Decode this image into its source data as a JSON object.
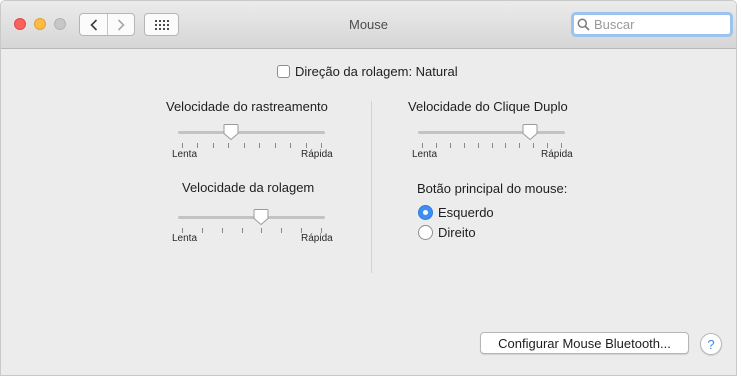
{
  "window": {
    "title": "Mouse",
    "search_placeholder": "Buscar"
  },
  "scroll_direction": {
    "label": "Direção da rolagem: Natural",
    "checked": false
  },
  "tracking_speed": {
    "label": "Velocidade do rastreamento",
    "min_label": "Lenta",
    "max_label": "Rápida",
    "value": 0.35
  },
  "scroll_speed": {
    "label": "Velocidade da rolagem",
    "min_label": "Lenta",
    "max_label": "Rápida",
    "value": 0.57
  },
  "double_click_speed": {
    "label": "Velocidade do Clique Duplo",
    "min_label": "Lenta",
    "max_label": "Rápida",
    "value": 0.78
  },
  "primary_button": {
    "label": "Botão principal do mouse:",
    "options": [
      "Esquerdo",
      "Direito"
    ],
    "selected": "Esquerdo"
  },
  "footer": {
    "bluetooth_button": "Configurar Mouse Bluetooth...",
    "help": "?"
  },
  "colors": {
    "accent": "#3d8ff5",
    "search_focus": "#9cc3ef",
    "close": "#fc605c",
    "minimize": "#fdbc40"
  }
}
